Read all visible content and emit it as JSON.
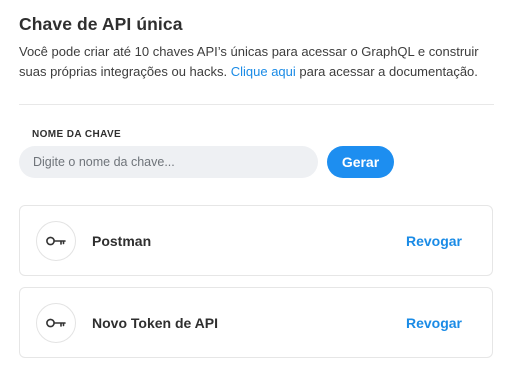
{
  "header": {
    "title": "Chave de API única",
    "description_before": "Você pode criar até 10 chaves API’s únicas para acessar o GraphQL e construir suas próprias integrações ou hacks. ",
    "link_text": "Clique aqui",
    "description_after": " para acessar a documentação."
  },
  "form": {
    "label": "NOME DA CHAVE",
    "placeholder": "Digite o nome da chave...",
    "value": "",
    "generate_label": "Gerar"
  },
  "keys": [
    {
      "name": "Postman",
      "icon": "key-icon",
      "action": "Revogar"
    },
    {
      "name": "Novo Token de API",
      "icon": "key-icon",
      "action": "Revogar"
    }
  ],
  "colors": {
    "accent": "#1d8ef0",
    "link": "#1a8be6",
    "input_bg": "#eef0f3"
  }
}
